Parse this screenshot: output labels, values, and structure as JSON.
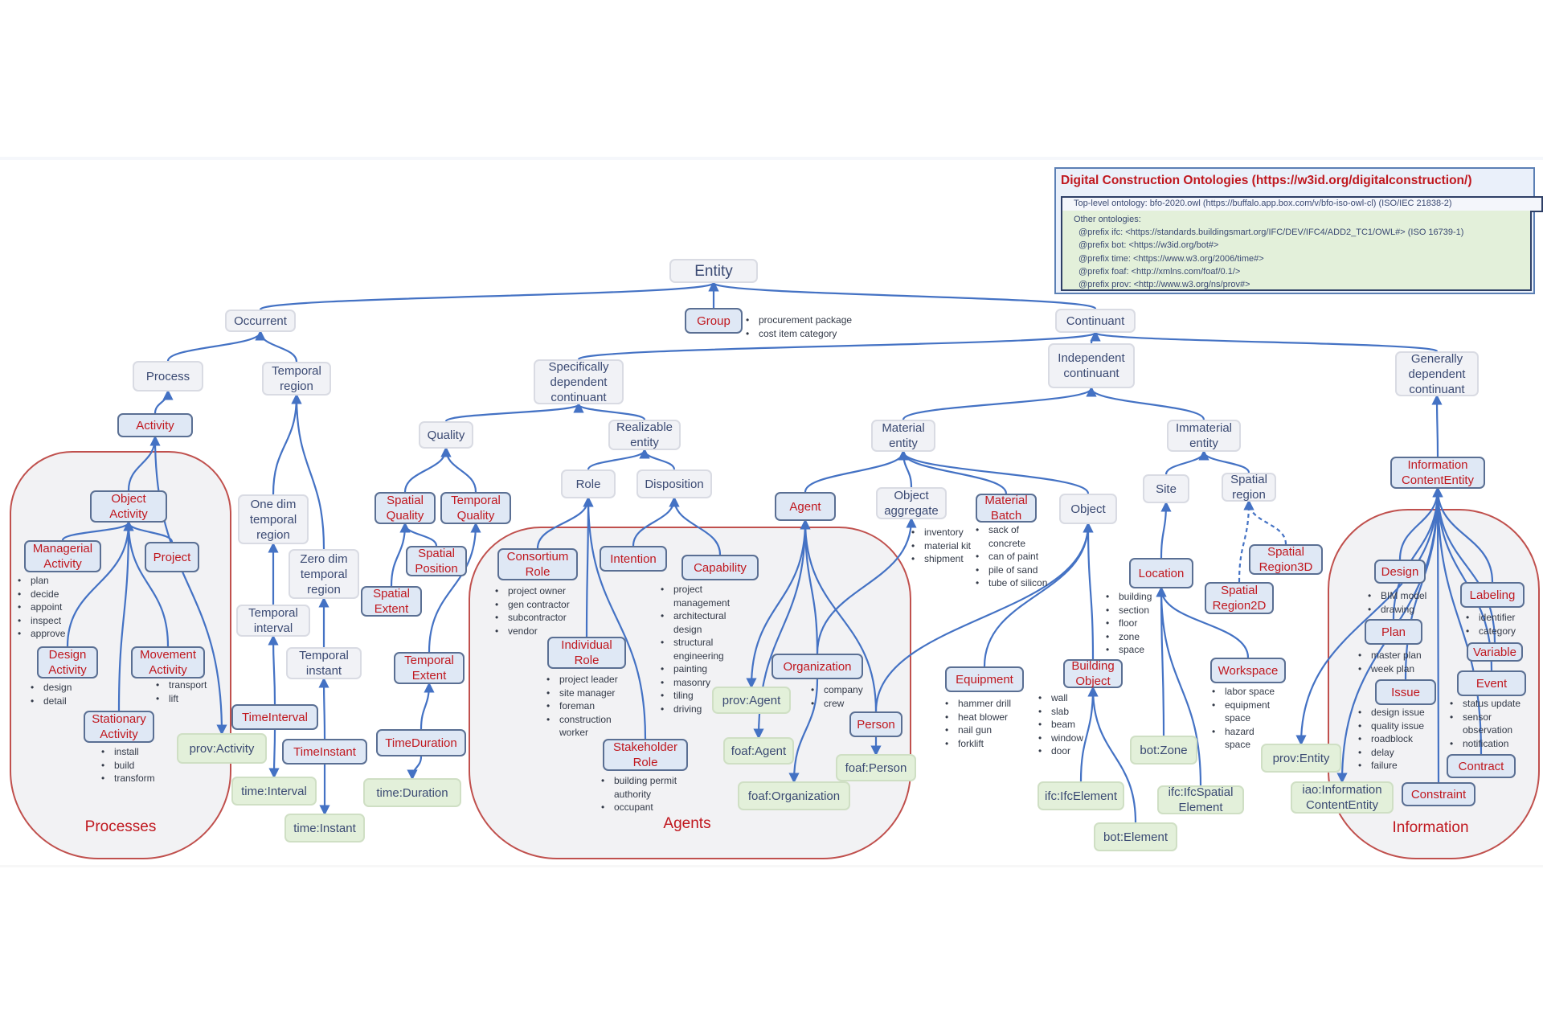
{
  "legend": {
    "title": "Digital Construction Ontologies (https://w3id.org/digitalconstruction/)",
    "top_level": "Top-level ontology: bfo-2020.owl (https://buffalo.app.box.com/v/bfo-iso-owl-cl) (ISO/IEC 21838-2)",
    "other_label": "Other ontologies:",
    "prefixes": [
      "@prefix ifc: <https://standards.buildingsmart.org/IFC/DEV/IFC4/ADD2_TC1/OWL#> (ISO 16739-1)",
      "@prefix bot: <https://w3id.org/bot#>",
      "@prefix time: <https://www.w3.org/2006/time#>",
      "@prefix foaf: <http://xmlns.com/foaf/0.1/>",
      "@prefix prov: <http://www.w3.org/ns/prov#>"
    ]
  },
  "groups": {
    "processes": "Processes",
    "agents": "Agents",
    "information": "Information"
  },
  "nodes": {
    "entity": "Entity",
    "occurrent": "Occurrent",
    "group": "Group",
    "continuant": "Continuant",
    "process": "Process",
    "temporal_region": "Temporal region",
    "specifically_dependent_continuant": "Specifically dependent continuant",
    "independent_continuant": "Independent continuant",
    "generally_dependent_continuant": "Generally dependent continuant",
    "activity": "Activity",
    "quality": "Quality",
    "realizable_entity": "Realizable entity",
    "material_entity": "Material entity",
    "immaterial_entity": "Immaterial entity",
    "information_content_entity": "Information ContentEntity",
    "object_activity": "Object Activity",
    "managerial_activity": "Managerial Activity",
    "project": "Project",
    "design_activity": "Design Activity",
    "movement_activity": "Movement Activity",
    "stationary_activity": "Stationary Activity",
    "prov_activity": "prov:Activity",
    "one_dim_temporal_region": "One dim temporal region",
    "zero_dim_temporal_region": "Zero dim temporal region",
    "temporal_interval": "Temporal interval",
    "temporal_instant": "Temporal instant",
    "time_interval_dice": "TimeInterval",
    "time_instant_dice": "TimeInstant",
    "time_interval": "time:Interval",
    "time_instant": "time:Instant",
    "spatial_quality": "Spatial Quality",
    "temporal_quality": "Temporal Quality",
    "spatial_position": "Spatial Position",
    "spatial_extent": "Spatial Extent",
    "temporal_extent": "Temporal Extent",
    "time_duration_dice": "TimeDuration",
    "time_duration": "time:Duration",
    "role": "Role",
    "disposition": "Disposition",
    "consortium_role": "Consortium Role",
    "individual_role": "Individual Role",
    "stakeholder_role": "Stakeholder Role",
    "intention": "Intention",
    "capability": "Capability",
    "agent": "Agent",
    "organization": "Organization",
    "person": "Person",
    "prov_agent": "prov:Agent",
    "foaf_agent": "foaf:Agent",
    "foaf_organization": "foaf:Organization",
    "foaf_person": "foaf:Person",
    "object_aggregate": "Object aggregate",
    "material_batch": "Material Batch",
    "object": "Object",
    "equipment": "Equipment",
    "building_object": "Building Object",
    "ifc_element": "ifc:IfcElement",
    "bot_element": "bot:Element",
    "site": "Site",
    "spatial_region": "Spatial region",
    "location": "Location",
    "spatial_region_3d": "Spatial Region3D",
    "spatial_region_2d": "Spatial Region2D",
    "workspace": "Workspace",
    "bot_zone": "bot:Zone",
    "ifc_spatial_element": "ifc:IfcSpatial Element",
    "design": "Design",
    "plan": "Plan",
    "issue": "Issue",
    "labeling": "Labeling",
    "variable": "Variable",
    "event": "Event",
    "contract": "Contract",
    "constraint": "Constraint",
    "prov_entity": "prov:Entity",
    "iao_ice": "iao:Information ContentEntity"
  },
  "bullets": {
    "group": [
      "procurement package",
      "cost item category"
    ],
    "managerial_activity": [
      "plan",
      "decide",
      "appoint",
      "inspect",
      "approve"
    ],
    "design_activity": [
      "design",
      "detail"
    ],
    "movement_activity": [
      "transport",
      "lift"
    ],
    "stationary_activity": [
      "install",
      "build",
      "transform"
    ],
    "consortium_role": [
      "project owner",
      "gen contractor",
      "subcontractor",
      "vendor"
    ],
    "individual_role": [
      "project leader",
      "site manager",
      "foreman",
      "construction worker"
    ],
    "stakeholder_role": [
      "building permit authority",
      "occupant"
    ],
    "capability": [
      "project management",
      "architectural design",
      "structural engineering",
      "painting",
      "masonry",
      "tiling",
      "driving"
    ],
    "organization": [
      "company",
      "crew"
    ],
    "object_aggregate": [
      "inventory",
      "material kit",
      "shipment"
    ],
    "material_batch": [
      "sack of concrete",
      "can of paint",
      "pile of sand",
      "tube of silicon"
    ],
    "equipment": [
      "hammer drill",
      "heat blower",
      "nail gun",
      "forklift"
    ],
    "building_object": [
      "wall",
      "slab",
      "beam",
      "window",
      "door"
    ],
    "location": [
      "building",
      "section",
      "floor",
      "zone",
      "space"
    ],
    "workspace": [
      "labor space",
      "equipment space",
      "hazard space"
    ],
    "design": [
      "BIM model",
      "drawing"
    ],
    "plan": [
      "master plan",
      "week plan"
    ],
    "issue": [
      "design issue",
      "quality issue",
      "roadblock",
      "delay",
      "failure"
    ],
    "labeling": [
      "identifier",
      "category"
    ],
    "event": [
      "status update",
      "sensor observation",
      "notification"
    ]
  },
  "colors": {
    "bfo_class": "#f1f2f6",
    "dice_class_text": "#c0181f",
    "dice_class_fill": "#dfe8f5",
    "external_class": "#e3f0da",
    "edge": "#4472c4",
    "group_border": "#c0504d"
  }
}
